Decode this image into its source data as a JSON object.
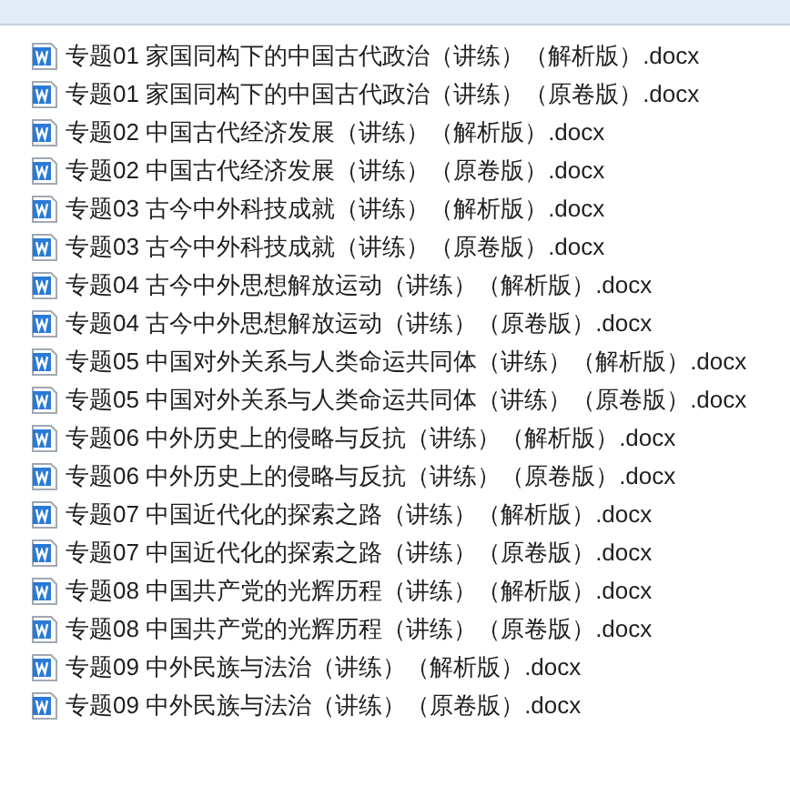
{
  "files": [
    {
      "name": "专题01 家国同构下的中国古代政治（讲练）（解析版）.docx"
    },
    {
      "name": "专题01 家国同构下的中国古代政治（讲练）（原卷版）.docx"
    },
    {
      "name": "专题02 中国古代经济发展（讲练）（解析版）.docx"
    },
    {
      "name": "专题02 中国古代经济发展（讲练）（原卷版）.docx"
    },
    {
      "name": "专题03 古今中外科技成就（讲练）（解析版）.docx"
    },
    {
      "name": "专题03 古今中外科技成就（讲练）（原卷版）.docx"
    },
    {
      "name": "专题04 古今中外思想解放运动（讲练）（解析版）.docx"
    },
    {
      "name": "专题04 古今中外思想解放运动（讲练）（原卷版）.docx"
    },
    {
      "name": "专题05 中国对外关系与人类命运共同体（讲练）（解析版）.docx"
    },
    {
      "name": "专题05 中国对外关系与人类命运共同体（讲练）（原卷版）.docx"
    },
    {
      "name": "专题06 中外历史上的侵略与反抗（讲练）（解析版）.docx"
    },
    {
      "name": "专题06 中外历史上的侵略与反抗（讲练）（原卷版）.docx"
    },
    {
      "name": "专题07 中国近代化的探索之路（讲练）（解析版）.docx"
    },
    {
      "name": "专题07 中国近代化的探索之路（讲练）（原卷版）.docx"
    },
    {
      "name": "专题08 中国共产党的光辉历程（讲练）（解析版）.docx"
    },
    {
      "name": "专题08 中国共产党的光辉历程（讲练）（原卷版）.docx"
    },
    {
      "name": "专题09 中外民族与法治（讲练）（解析版）.docx"
    },
    {
      "name": "专题09 中外民族与法治（讲练）（原卷版）.docx"
    }
  ]
}
